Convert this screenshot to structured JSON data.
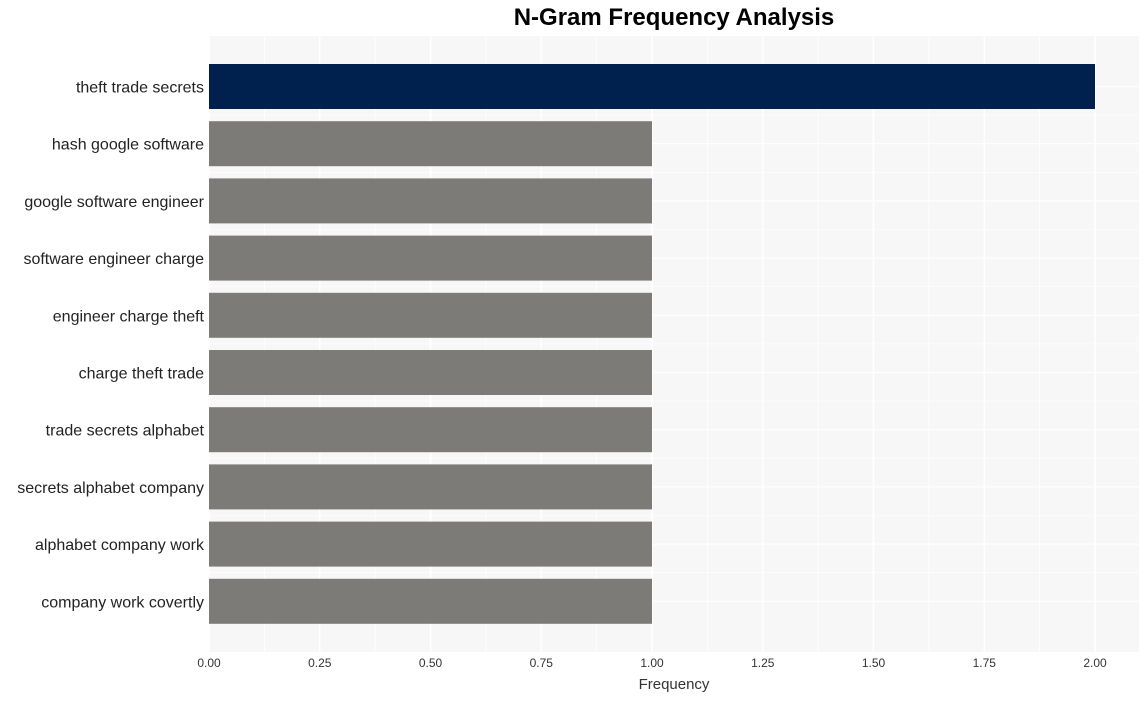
{
  "chart_data": {
    "type": "bar",
    "orientation": "horizontal",
    "title": "N-Gram Frequency Analysis",
    "xlabel": "Frequency",
    "ylabel": "",
    "xlim": [
      0,
      2.1
    ],
    "xticks": [
      "0.00",
      "0.25",
      "0.50",
      "0.75",
      "1.00",
      "1.25",
      "1.50",
      "1.75",
      "2.00"
    ],
    "grid": true,
    "categories": [
      "theft trade secrets",
      "hash google software",
      "google software engineer",
      "software engineer charge",
      "engineer charge theft",
      "charge theft trade",
      "trade secrets alphabet",
      "secrets alphabet company",
      "alphabet company work",
      "company work covertly"
    ],
    "values": [
      2,
      1,
      1,
      1,
      1,
      1,
      1,
      1,
      1,
      1
    ],
    "colors": {
      "highlight": "#00214d",
      "default": "#7c7b78",
      "panel_background": "#f7f7f7",
      "gridline": "#ffffff"
    }
  }
}
